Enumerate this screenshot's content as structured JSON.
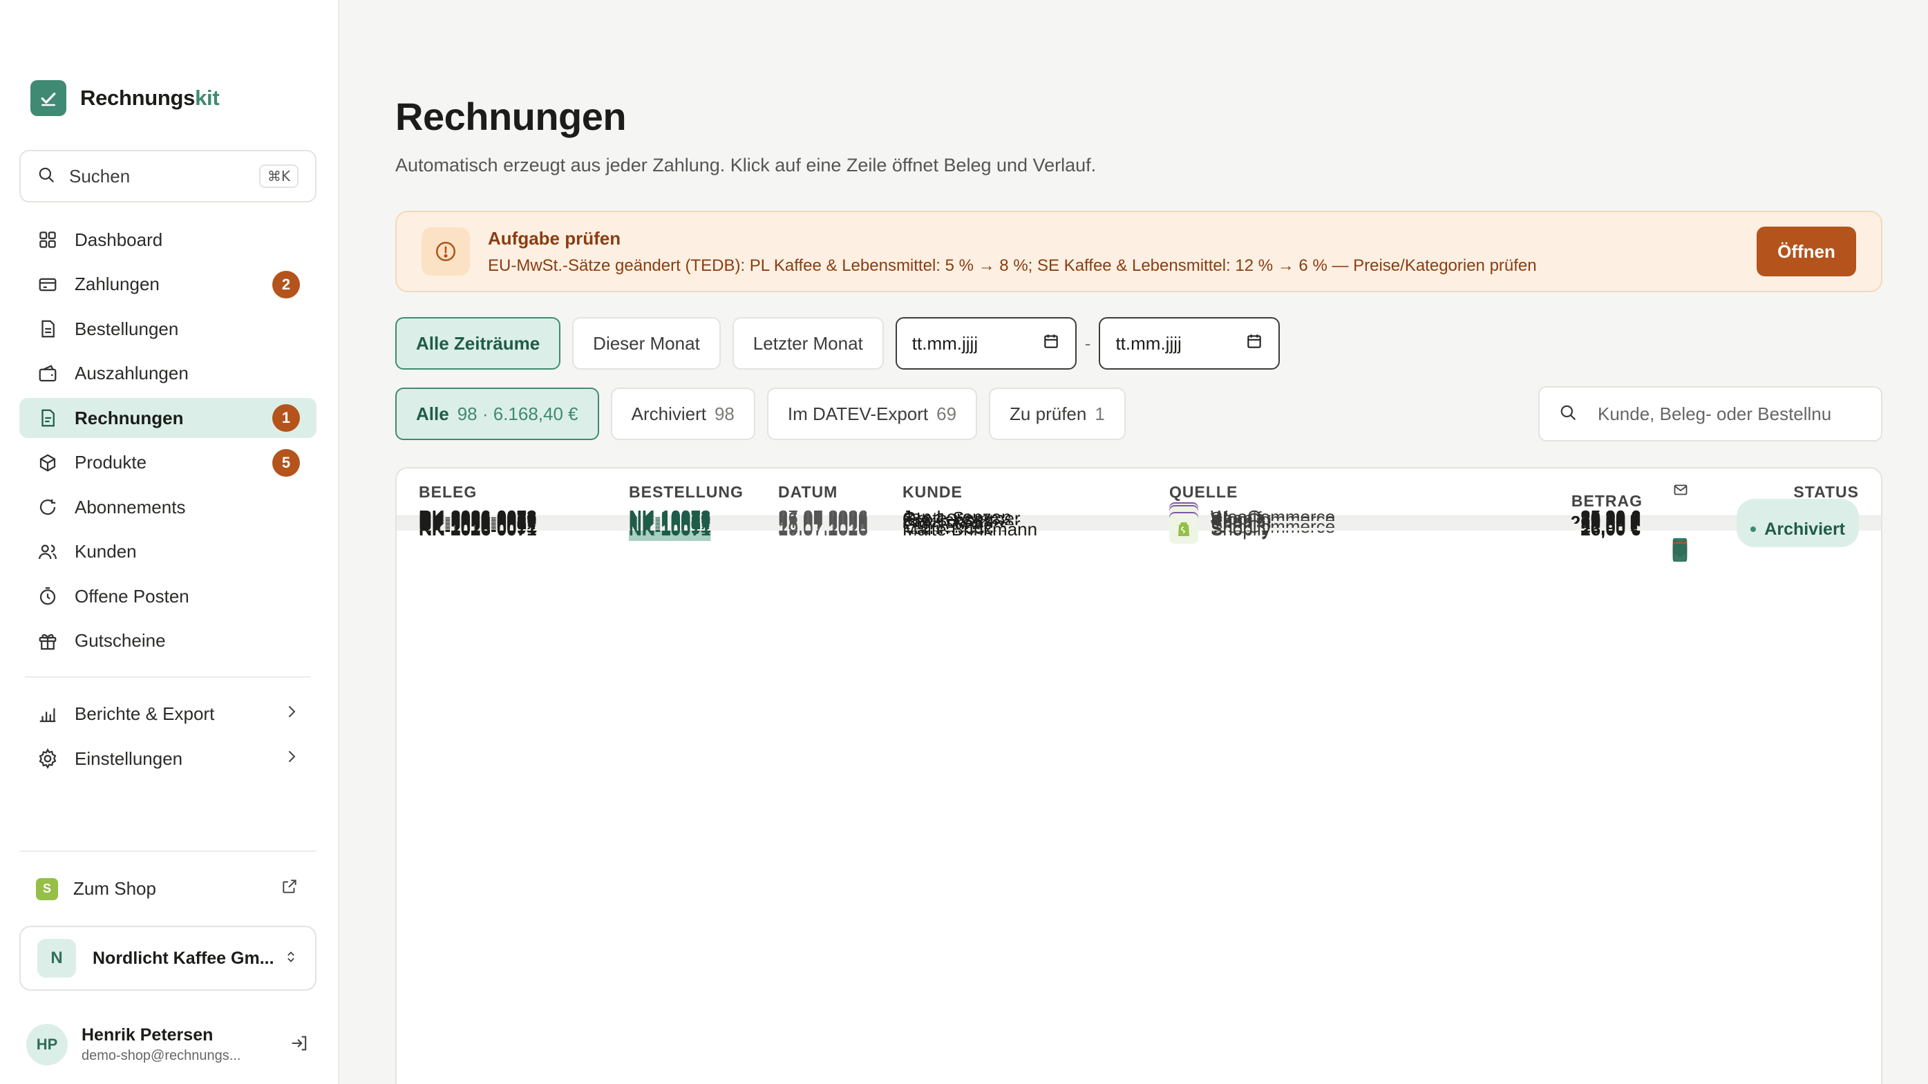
{
  "brand": {
    "name_main": "Rechnungs",
    "name_accent": "kit",
    "color": "#3f8a72"
  },
  "sidebar": {
    "search_label": "Suchen",
    "search_shortcut": "⌘K",
    "items": [
      {
        "label": "Dashboard",
        "icon": "grid-icon",
        "badge": ""
      },
      {
        "label": "Zahlungen",
        "icon": "card-icon",
        "badge": "2"
      },
      {
        "label": "Bestellungen",
        "icon": "document-icon",
        "badge": ""
      },
      {
        "label": "Auszahlungen",
        "icon": "wallet-icon",
        "badge": ""
      },
      {
        "label": "Rechnungen",
        "icon": "invoice-icon",
        "badge": "1",
        "active": true
      },
      {
        "label": "Produkte",
        "icon": "box-icon",
        "badge": "5"
      },
      {
        "label": "Abonnements",
        "icon": "refresh-icon",
        "badge": ""
      },
      {
        "label": "Kunden",
        "icon": "users-icon",
        "badge": ""
      },
      {
        "label": "Offene Posten",
        "icon": "timer-icon",
        "badge": ""
      },
      {
        "label": "Gutscheine",
        "icon": "gift-icon",
        "badge": ""
      }
    ],
    "secondary": [
      {
        "label": "Berichte & Export",
        "icon": "bar-chart-icon"
      },
      {
        "label": "Einstellungen",
        "icon": "gear-icon"
      }
    ],
    "to_shop": "Zum Shop",
    "org": {
      "initial": "N",
      "name": "Nordlicht Kaffee Gm..."
    },
    "user": {
      "initials": "HP",
      "name": "Henrik Petersen",
      "email": "demo-shop@rechnungs..."
    }
  },
  "page": {
    "title": "Rechnungen",
    "subtitle": "Automatisch erzeugt aus jeder Zahlung. Klick auf eine Zeile öffnet Beleg und Verlauf."
  },
  "alert": {
    "title": "Aufgabe prüfen",
    "description": "EU-MwSt.-Sätze geändert (TEDB): PL Kaffee & Lebensmittel: 5 % → 8 %; SE Kaffee & Lebensmittel: 12 % → 6 % — Preise/Kategorien prüfen",
    "button": "Öffnen"
  },
  "period_filters": [
    "Alle Zeiträume",
    "Dieser Monat",
    "Letzter Monat"
  ],
  "date_from": "tt.mm.jjjj",
  "date_to": "tt.mm.jjjj",
  "date_separator": "-",
  "status_filters": [
    {
      "label": "Alle",
      "count": "98",
      "extra": " · 6.168,40 €"
    },
    {
      "label": "Archiviert",
      "count": "98",
      "extra": ""
    },
    {
      "label": "Im DATEV-Export",
      "count": "69",
      "extra": ""
    },
    {
      "label": "Zu prüfen",
      "count": "1",
      "extra": ""
    }
  ],
  "table_search_placeholder": "Kunde, Beleg- oder Bestellnummer",
  "table": {
    "headers": {
      "beleg": "BELEG",
      "bestellung": "BESTELLUNG",
      "datum": "DATUM",
      "kunde": "KUNDE",
      "quelle": "QUELLE",
      "betrag": "BETRAG",
      "status": "STATUS"
    },
    "rows": [
      {
        "beleg": "RK-2026-0073",
        "bestellung": "NK-10073",
        "datum": "27.07.2026",
        "kunde": "Jan Lorenzen",
        "quelle": "WooCommerce",
        "betrag": "35,90 €",
        "mail": "sent",
        "status": "Archiviert"
      },
      {
        "beleg": "RK-2026-0076",
        "bestellung": "NK-10076",
        "datum": "26.07.2026",
        "kunde": "Greta Sommer",
        "quelle": "Shopify",
        "betrag": "32,20 €",
        "mail": "sent",
        "status": "Archiviert"
      },
      {
        "beleg": "RK-2026-0079",
        "bestellung": "NK-10079",
        "datum": "25.07.2026",
        "kunde": "Ole Jansen",
        "quelle": "WooCommerce",
        "betrag": "39,00 €",
        "mail": "sent",
        "status": "Archiviert"
      },
      {
        "beleg": "RK-2026-0082",
        "bestellung": "NK-10082",
        "datum": "24.07.2026",
        "kunde": "Katrin Voss",
        "quelle": "Shopify",
        "betrag": "19,20 €",
        "mail": "failed",
        "status": "Archiviert"
      },
      {
        "beleg": "RK-2026-0085",
        "bestellung": "NK-10085",
        "datum": "23.07.2026",
        "kunde": "Jan Lorenzen",
        "quelle": "Shopify",
        "betrag": "249,00 €",
        "mail": "sent",
        "status": "Archiviert"
      },
      {
        "beleg": "RK-2026-0088",
        "bestellung": "NK-10088",
        "datum": "22.07.2026",
        "kunde": "Greta Sommer",
        "quelle": "Shopify",
        "betrag": "35,00 €",
        "mail": "sent",
        "status": "Archiviert"
      },
      {
        "beleg": "RK-2026-0098",
        "bestellung": "NK-10098",
        "datum": "21.07.2026",
        "kunde": "Elise Peeters",
        "quelle": "Shopify",
        "betrag": "35,59 €",
        "mail": "sent",
        "status": "Archiviert"
      },
      {
        "beleg": "RK-2026-0091",
        "bestellung": "NK-10091",
        "datum": "21.07.2026",
        "kunde": "Ole Jansen",
        "quelle": "WooCommerce",
        "betrag": "26,00 €",
        "mail": "sent",
        "status": "Archiviert"
      },
      {
        "beleg": "RK-2026-0094",
        "bestellung": "NK-10094",
        "datum": "20.07.2026",
        "kunde": "Katrin Voss",
        "quelle": "Shopify",
        "betrag": "57,90 €",
        "mail": "sent",
        "status": "Archiviert"
      },
      {
        "beleg": "RK-2026-0071",
        "bestellung": "NK-10071",
        "datum": "19.07.2026",
        "kunde": "Malte Brinkmann",
        "quelle": "Shopify",
        "betrag": "26,00 €",
        "mail": "sent",
        "status": "Archiviert"
      }
    ]
  },
  "colors": {
    "accent": "#3f8a72",
    "warning": "#b4531c",
    "woo": "#7f54b3",
    "shopify": "#95bf47"
  }
}
